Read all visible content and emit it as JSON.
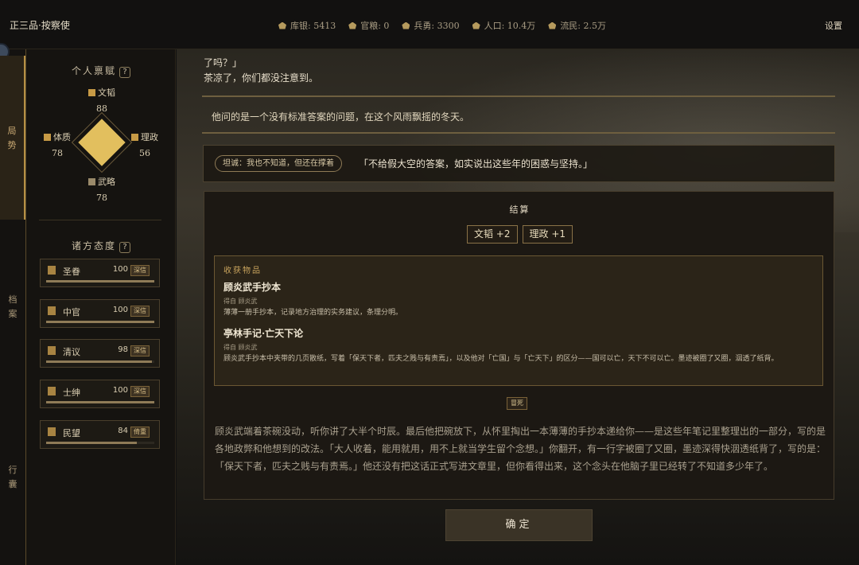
{
  "topbar": {
    "rank": "正三品·按察使",
    "stats": [
      {
        "icon": "silver-icon",
        "text": "库银: 5413"
      },
      {
        "icon": "grain-icon",
        "text": "官粮: 0"
      },
      {
        "icon": "soldier-icon",
        "text": "兵勇: 3300"
      },
      {
        "icon": "population-icon",
        "text": "人口: 10.4万"
      },
      {
        "icon": "refugee-icon",
        "text": "流民: 2.5万"
      }
    ],
    "settings": "设置"
  },
  "rail": {
    "tabs": [
      {
        "chars": [
          "局",
          "势"
        ],
        "active": true
      },
      {
        "chars": [
          "档",
          "案"
        ],
        "active": false
      },
      {
        "chars": [
          "行",
          "囊"
        ],
        "active": false
      }
    ]
  },
  "talents": {
    "title": "个人禀赋",
    "help": "?",
    "wentao": {
      "label": "文韬",
      "value": "88"
    },
    "tizhi": {
      "label": "体质",
      "value": "78"
    },
    "lizheng": {
      "label": "理政",
      "value": "56"
    },
    "wulue": {
      "label": "武略",
      "value": "78"
    }
  },
  "attitudes": {
    "title": "诸方态度",
    "help": "?",
    "factions": [
      {
        "name": "圣眷",
        "value": "100",
        "tag": "深信",
        "level": 1.0
      },
      {
        "name": "中官",
        "value": "100",
        "tag": "深信",
        "level": 1.0
      },
      {
        "name": "清议",
        "value": "98",
        "tag": "深信",
        "level": 0.98
      },
      {
        "name": "士绅",
        "value": "100",
        "tag": "深信",
        "level": 1.0
      },
      {
        "name": "民望",
        "value": "84",
        "tag": "倚重",
        "level": 0.84
      }
    ]
  },
  "main": {
    "dialog_line1": "了吗？」",
    "dialog_line2": "茶凉了，你们都没注意到。",
    "narration": "他问的是一个没有标准答案的问题，在这个风雨飘摇的冬天。",
    "choice_tag": "坦诚：我也不知道，但还在撑着",
    "choice_text": "「不给假大空的答案，如实说出这些年的困惑与坚持。」",
    "result": {
      "title": "结算",
      "gains": [
        "文韬 +2",
        "理政 +1"
      ],
      "items_title": "收获物品",
      "items": [
        {
          "name": "顾炎武手抄本",
          "source": "得自 顾炎武",
          "desc": "薄薄一册手抄本，记录地方治理的实务建议，条理分明。"
        },
        {
          "name": "亭林手记·亡天下论",
          "source": "得自 顾炎武",
          "desc": "顾炎武手抄本中夹带的几页散纸，写着「保天下者，匹夫之贱与有责焉」，以及他对「亡国」与「亡天下」的区分——国可以亡，天下不可以亡。墨迹被圈了又圈，洇透了纸背。"
        }
      ],
      "death_tag": "冒死",
      "story": "顾炎武端着茶碗没动，听你讲了大半个时辰。最后他把碗放下，从怀里掏出一本薄薄的手抄本递给你——是这些年笔记里整理出的一部分，写的是各地政弊和他想到的改法。「大人收着，能用就用，用不上就当学生留个念想。」你翻开，有一行字被圈了又圈，墨迹深得快洇透纸背了，写的是：「保天下者，匹夫之贱与有责焉。」他还没有把这话正式写进文章里，但你看得出来，这个念头在他脑子里已经转了不知道多少年了。"
    },
    "confirm": "确定"
  }
}
